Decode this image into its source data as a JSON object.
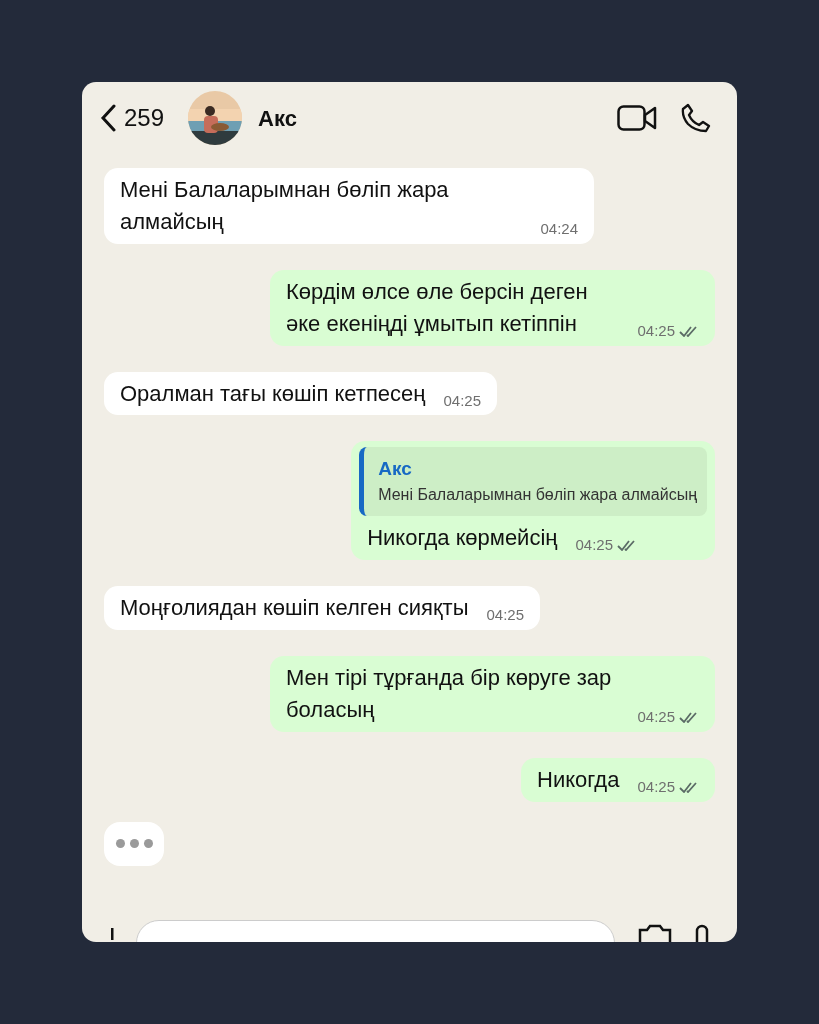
{
  "header": {
    "back_count": "259",
    "contact_name": "Акс"
  },
  "messages": [
    {
      "kind": "incoming",
      "text": "Мені Балаларымнан бөліп жара алмайсың",
      "time": "04:24"
    },
    {
      "kind": "outgoing",
      "text": "Көрдім өлсе өле берсін деген әке екеніңді ұмытып кетіппін",
      "time": "04:25",
      "read": true
    },
    {
      "kind": "incoming",
      "text": "Оралман тағы көшіп кетпесең",
      "time": "04:25"
    },
    {
      "kind": "outgoing",
      "reply": {
        "author": "Акс",
        "text": "Мені Балаларымнан бөліп жара алмайсың"
      },
      "text": "Никогда көрмейсің",
      "time": "04:25",
      "read": true
    },
    {
      "kind": "incoming",
      "text": "Моңғолиядан көшіп келген сияқты",
      "time": "04:25"
    },
    {
      "kind": "outgoing",
      "text": "Мен тірі тұрғанда бір көруге зар боласың",
      "time": "04:25",
      "read": true
    },
    {
      "kind": "outgoing",
      "text": "Никогда",
      "time": "04:25",
      "read": true
    }
  ],
  "typing": true
}
